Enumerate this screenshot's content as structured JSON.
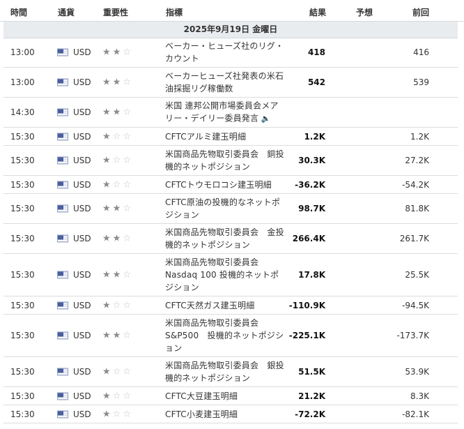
{
  "columns": {
    "time": "時間",
    "currency": "通貨",
    "importance": "重要性",
    "indicator": "指標",
    "actual": "結果",
    "forecast": "予想",
    "previous": "前回"
  },
  "date_header": "2025年9月19日 金曜日",
  "rows": [
    {
      "time": "13:00",
      "currency": "USD",
      "stars": 2,
      "name": "ベーカー・ヒューズ社のリグ・カウント",
      "actual": "418",
      "forecast": "",
      "previous": "416",
      "speech": false
    },
    {
      "time": "13:00",
      "currency": "USD",
      "stars": 2,
      "name": "ベーカーヒューズ社発表の米石油採掘リグ稼働数",
      "actual": "542",
      "forecast": "",
      "previous": "539",
      "speech": false
    },
    {
      "time": "14:30",
      "currency": "USD",
      "stars": 2,
      "name": "米国 連邦公開市場委員会メアリー・デイリー委員発言",
      "actual": "",
      "forecast": "",
      "previous": "",
      "speech": true
    },
    {
      "time": "15:30",
      "currency": "USD",
      "stars": 1,
      "name": "CFTCアルミ建玉明細",
      "actual": "1.2K",
      "forecast": "",
      "previous": "1.2K",
      "speech": false
    },
    {
      "time": "15:30",
      "currency": "USD",
      "stars": 1,
      "name": "米国商品先物取引委員会　銅投機的ネットポジション",
      "actual": "30.3K",
      "forecast": "",
      "previous": "27.2K",
      "speech": false
    },
    {
      "time": "15:30",
      "currency": "USD",
      "stars": 1,
      "name": "CFTCトウモロコシ建玉明細",
      "actual": "-36.2K",
      "forecast": "",
      "previous": "-54.2K",
      "speech": false
    },
    {
      "time": "15:30",
      "currency": "USD",
      "stars": 2,
      "name": "CFTC原油の投機的なネットポジション",
      "actual": "98.7K",
      "forecast": "",
      "previous": "81.8K",
      "speech": false
    },
    {
      "time": "15:30",
      "currency": "USD",
      "stars": 2,
      "name": "米国商品先物取引委員会　金投機的ネットポジション",
      "actual": "266.4K",
      "forecast": "",
      "previous": "261.7K",
      "speech": false
    },
    {
      "time": "15:30",
      "currency": "USD",
      "stars": 2,
      "name": "米国商品先物取引委員会 Nasdaq 100 投機的ネットポジション",
      "actual": "17.8K",
      "forecast": "",
      "previous": "25.5K",
      "speech": false
    },
    {
      "time": "15:30",
      "currency": "USD",
      "stars": 1,
      "name": "CFTC天然ガス建玉明細",
      "actual": "-110.9K",
      "forecast": "",
      "previous": "-94.5K",
      "speech": false
    },
    {
      "time": "15:30",
      "currency": "USD",
      "stars": 2,
      "name": "米国商品先物取引委員会 S&P500　投機的ネットポジション",
      "actual": "-225.1K",
      "forecast": "",
      "previous": "-173.7K",
      "speech": false
    },
    {
      "time": "15:30",
      "currency": "USD",
      "stars": 1,
      "name": "米国商品先物取引委員会　銀投機的ネットポジション",
      "actual": "51.5K",
      "forecast": "",
      "previous": "53.9K",
      "speech": false
    },
    {
      "time": "15:30",
      "currency": "USD",
      "stars": 1,
      "name": "CFTC大豆建玉明細",
      "actual": "21.2K",
      "forecast": "",
      "previous": "8.3K",
      "speech": false
    },
    {
      "time": "15:30",
      "currency": "USD",
      "stars": 1,
      "name": "CFTC小麦建玉明細",
      "actual": "-72.2K",
      "forecast": "",
      "previous": "-82.1K",
      "speech": false
    }
  ],
  "icons": {
    "flag": "us-flag-icon",
    "star": "star-icon",
    "speech": "speaker-icon"
  },
  "colors": {
    "date_band": "#e9ecef",
    "star_on": "#8a8a8a",
    "star_off": "#c4c4c4",
    "border": "#dcdcdc"
  }
}
